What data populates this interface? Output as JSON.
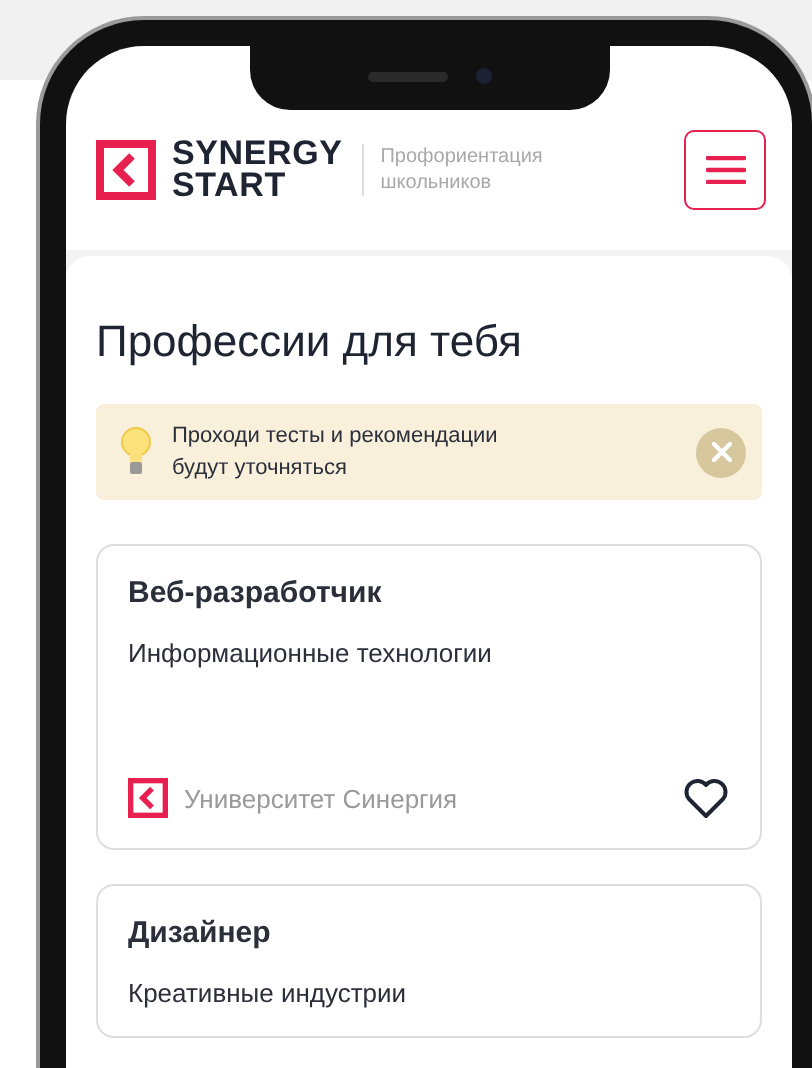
{
  "header": {
    "logo": {
      "line_1": "SYNERGY",
      "line_2": "START"
    },
    "tagline": "Профориентация школьников"
  },
  "title": "Профессии для тебя",
  "notice": {
    "text": "Проходи тесты и рекомендации будут уточняться"
  },
  "cards": [
    {
      "title": "Веб-разработчик",
      "category": "Информационные технологии",
      "university": "Университет Синергия",
      "favorite": false
    },
    {
      "title": "Дизайнер",
      "category": "Креативные индустрии"
    }
  ]
}
